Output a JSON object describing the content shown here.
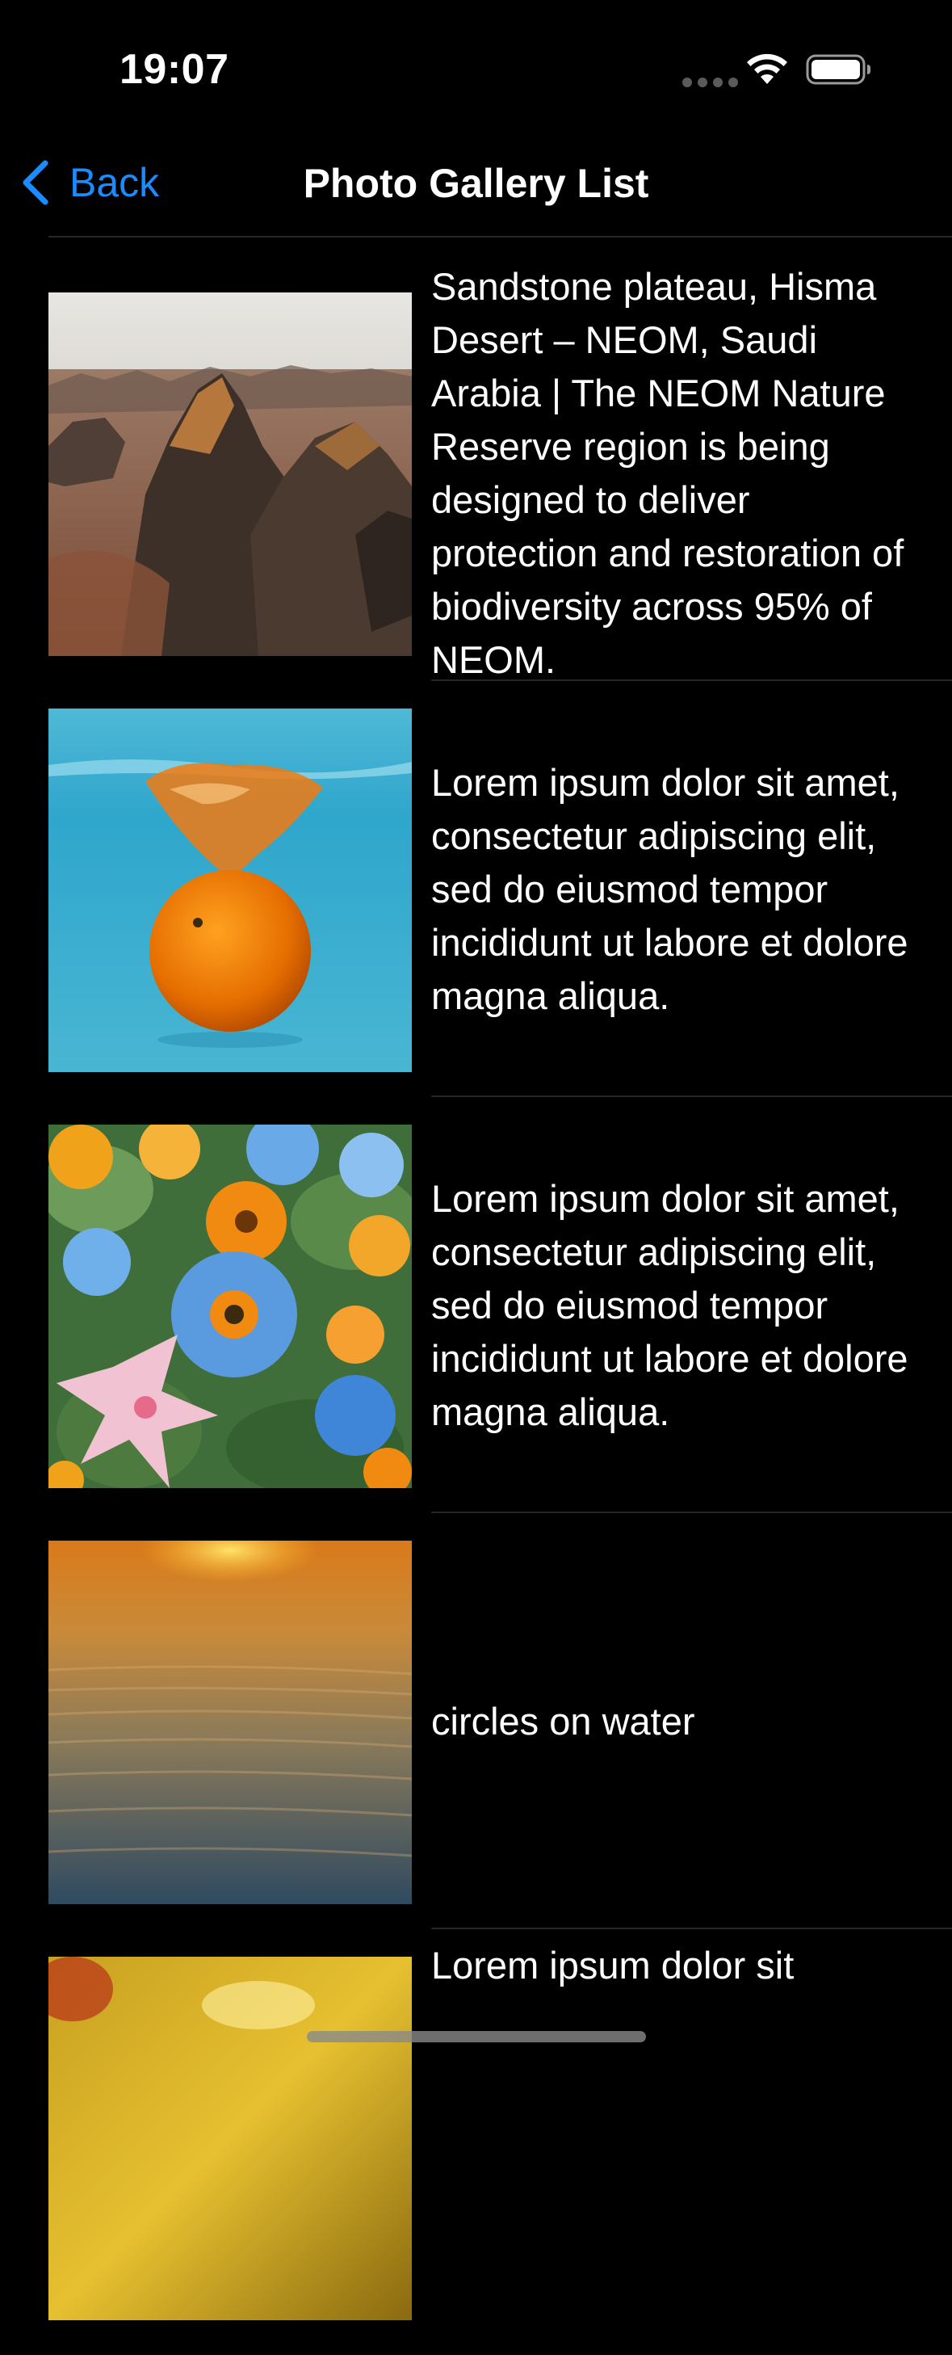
{
  "status_bar": {
    "time": "19:07"
  },
  "nav": {
    "back_label": "Back",
    "title": "Photo Gallery List"
  },
  "colors": {
    "background": "#000000",
    "accent": "#1a8cff",
    "divider": "#262626",
    "text": "#ffffff"
  },
  "gallery": {
    "items": [
      {
        "image": "desert-rock-plateau-photo",
        "caption": "Sandstone plateau, Hisma Desert – NEOM, Saudi Arabia | The NEOM Nature Reserve region is being designed to deliver protection and restoration of biodiversity across 95% of NEOM."
      },
      {
        "image": "orange-in-water-photo",
        "caption": "Lorem ipsum dolor sit amet, consectetur adipiscing elit, sed do eiusmod tempor incididunt ut labore et dolore magna aliqua."
      },
      {
        "image": "colorful-flowers-photo",
        "caption": "Lorem ipsum dolor sit amet, consectetur adipiscing elit, sed do eiusmod tempor incididunt ut labore et dolore magna aliqua."
      },
      {
        "image": "sunset-water-circles-photo",
        "caption": "circles on water"
      },
      {
        "image": "yellow-abstract-photo",
        "caption": "Lorem ipsum dolor sit"
      }
    ]
  }
}
